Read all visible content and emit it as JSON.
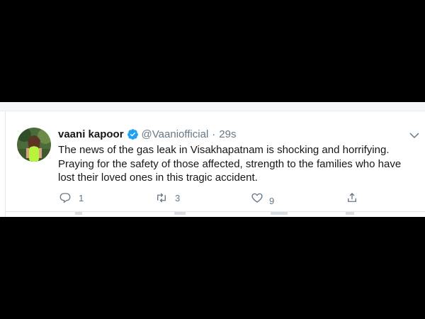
{
  "tweet": {
    "display_name": "vaani kapoor",
    "handle": "@Vaaniofficial",
    "separator": "·",
    "timestamp": "29s",
    "text": "The news of the gas leak in Visakhapatnam is shocking and horrifying. Praying for the safety of those affected, strength to the families who have lost their loved ones in this tragic accident.",
    "replies": "1",
    "retweets": "3",
    "likes": "9",
    "verified_color": "#1da1f2",
    "icons": [
      "reply-icon",
      "retweet-icon",
      "like-icon",
      "share-icon",
      "chevron-down-icon",
      "verified-badge-icon"
    ]
  }
}
